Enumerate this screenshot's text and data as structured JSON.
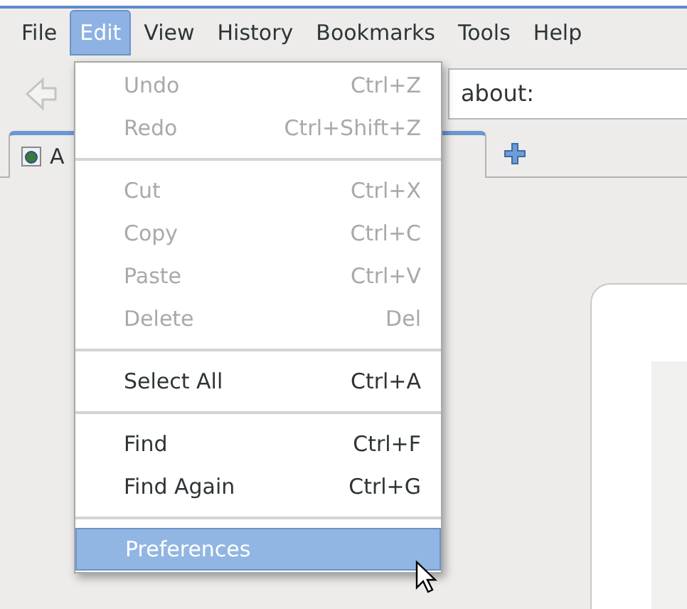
{
  "menubar": [
    {
      "label": "File",
      "selected": false
    },
    {
      "label": "Edit",
      "selected": true
    },
    {
      "label": "View",
      "selected": false
    },
    {
      "label": "History",
      "selected": false
    },
    {
      "label": "Bookmarks",
      "selected": false
    },
    {
      "label": "Tools",
      "selected": false
    },
    {
      "label": "Help",
      "selected": false
    }
  ],
  "toolbar": {
    "url": "about:"
  },
  "tabs": [
    {
      "label": "A",
      "selected": true
    }
  ],
  "menu": [
    {
      "kind": "item",
      "label": "Undo",
      "shortcut": "Ctrl+Z",
      "disabled": true,
      "selected": false
    },
    {
      "kind": "item",
      "label": "Redo",
      "shortcut": "Ctrl+Shift+Z",
      "disabled": true,
      "selected": false
    },
    {
      "kind": "separator"
    },
    {
      "kind": "item",
      "label": "Cut",
      "shortcut": "Ctrl+X",
      "disabled": true,
      "selected": false
    },
    {
      "kind": "item",
      "label": "Copy",
      "shortcut": "Ctrl+C",
      "disabled": true,
      "selected": false
    },
    {
      "kind": "item",
      "label": "Paste",
      "shortcut": "Ctrl+V",
      "disabled": true,
      "selected": false
    },
    {
      "kind": "item",
      "label": "Delete",
      "shortcut": "Del",
      "disabled": true,
      "selected": false
    },
    {
      "kind": "separator"
    },
    {
      "kind": "item",
      "label": "Select All",
      "shortcut": "Ctrl+A",
      "disabled": false,
      "selected": false
    },
    {
      "kind": "separator"
    },
    {
      "kind": "item",
      "label": "Find",
      "shortcut": "Ctrl+F",
      "disabled": false,
      "selected": false
    },
    {
      "kind": "item",
      "label": "Find Again",
      "shortcut": "Ctrl+G",
      "disabled": false,
      "selected": false
    },
    {
      "kind": "separator"
    },
    {
      "kind": "item",
      "label": "Preferences",
      "disabled": false,
      "selected": true
    }
  ]
}
